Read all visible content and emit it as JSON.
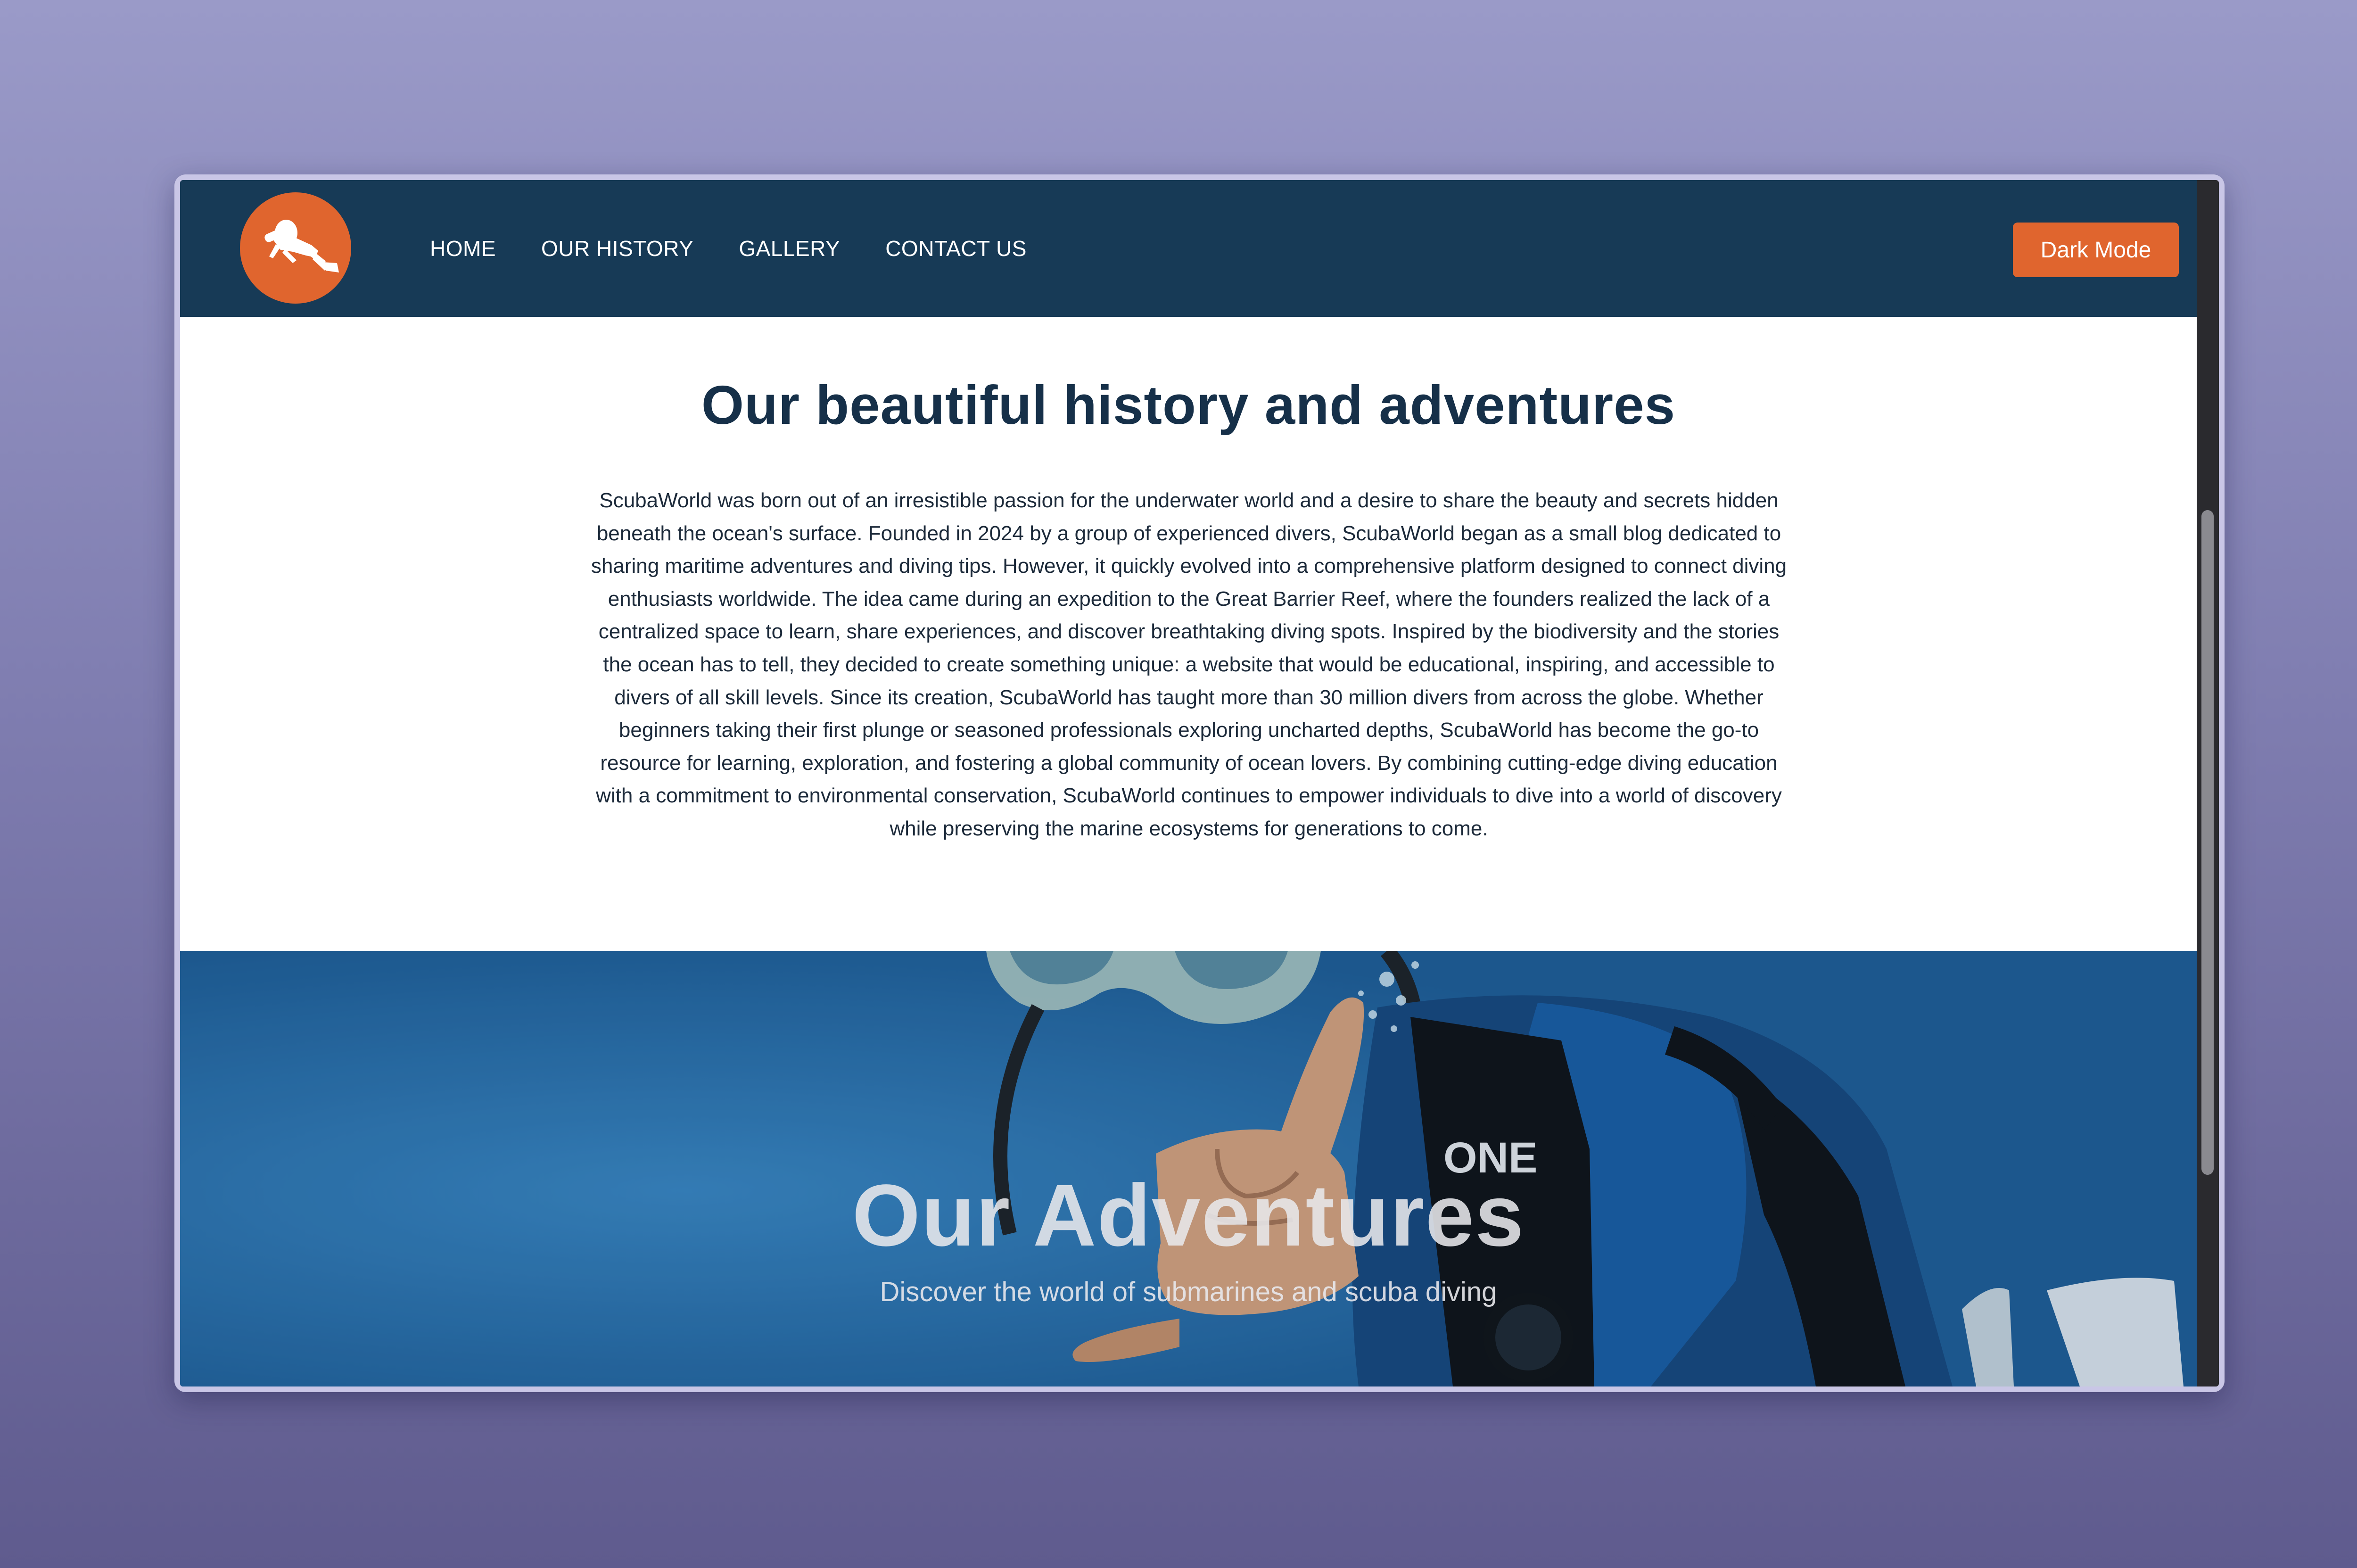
{
  "navbar": {
    "logo_icon": "scuba-diver-icon",
    "links": [
      "HOME",
      "OUR HISTORY",
      "GALLERY",
      "CONTACT US"
    ],
    "dark_mode_label": "Dark Mode"
  },
  "history": {
    "title": "Our beautiful history and adventures",
    "text": "ScubaWorld was born out of an irresistible passion for the underwater world and a desire to share the beauty and secrets hidden beneath the ocean's surface. Founded in 2024 by a group of experienced divers, ScubaWorld began as a small blog dedicated to sharing maritime adventures and diving tips. However, it quickly evolved into a comprehensive platform designed to connect diving enthusiasts worldwide. The idea came during an expedition to the Great Barrier Reef, where the founders realized the lack of a centralized space to learn, share experiences, and discover breathtaking diving spots. Inspired by the biodiversity and the stories the ocean has to tell, they decided to create something unique: a website that would be educational, inspiring, and accessible to divers of all skill levels. Since its creation, ScubaWorld has taught more than 30 million divers from across the globe. Whether beginners taking their first plunge or seasoned professionals exploring uncharted depths, ScubaWorld has become the go-to resource for learning, exploration, and fostering a global community of ocean lovers. By combining cutting-edge diving education with a commitment to environmental conservation, ScubaWorld continues to empower individuals to dive into a world of discovery while preserving the marine ecosystems for generations to come."
  },
  "hero": {
    "title": "Our Adventures",
    "subtitle": "Discover the world of submarines and scuba diving",
    "wetsuit_brand": "ONE"
  },
  "colors": {
    "navbar_bg": "#173a56",
    "accent": "#e0652e",
    "title_text": "#163049",
    "hero_water": "#2b73b2"
  }
}
